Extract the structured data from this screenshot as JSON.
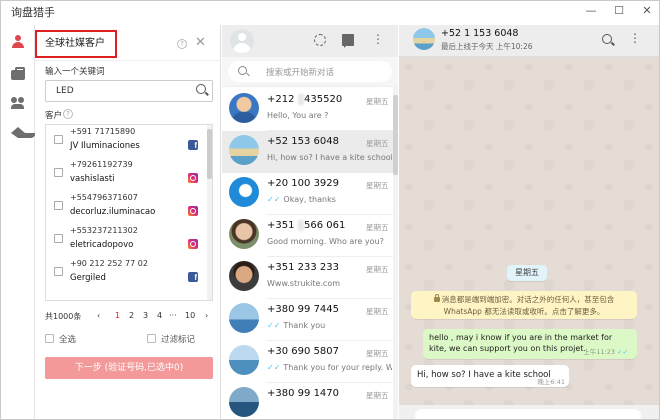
{
  "window": {
    "title": "询盘猎手",
    "controls": [
      "minimize",
      "maximize",
      "close"
    ]
  },
  "rail": {
    "icons": [
      "user-icon",
      "briefcase-icon",
      "group-icon",
      "graduation-cap-icon"
    ],
    "active_color": "#e0474c"
  },
  "left_panel": {
    "title": "全球社媒客户",
    "keyword_label": "输入一个关键词",
    "keyword_value": "LED",
    "customers_label": "客户",
    "customers": [
      {
        "phone": "+591 71715890",
        "name": "JV Iluminaciones",
        "platform": "facebook"
      },
      {
        "phone": "+79261192739",
        "name": "vashislasti",
        "platform": "instagram"
      },
      {
        "phone": "+554796371607",
        "name": "decorluz.iluminacao",
        "platform": "instagram"
      },
      {
        "phone": "+553237211302",
        "name": "eletricadopovo",
        "platform": "instagram"
      },
      {
        "phone": "+90 212 252 77 02",
        "name": "Gergiled",
        "platform": "facebook"
      }
    ],
    "pager": {
      "total": "共1000条",
      "prev": "‹",
      "pages": [
        "1",
        "2",
        "3",
        "4"
      ],
      "current": "1",
      "ellipsis": "···",
      "last": "10",
      "next": "›"
    },
    "select_all": "全选",
    "filter_marked": "过滤标记",
    "next_button": "下一步 (验证号码,已选中0)",
    "accent": "#e02020",
    "button_color": "#f39999"
  },
  "chat_list": {
    "search_placeholder": "搜索或开始新对话",
    "items": [
      {
        "name_prefix": "+212 ",
        "name_hidden": "6",
        "name_suffix": "435520",
        "time": "星期五",
        "preview": "Hello, You are ?",
        "ticks": false,
        "selected": false,
        "avatar": "blue-person"
      },
      {
        "name_prefix": "+52 1",
        "name_hidden": "    ",
        "name_suffix": "53 6048",
        "time": "星期五",
        "preview": "Hi, how so? I have a kite school",
        "ticks": false,
        "selected": true,
        "avatar": "kite-beach"
      },
      {
        "name_prefix": "+20 100 ",
        "name_hidden": "   ",
        "name_suffix": "3929",
        "time": "星期五",
        "preview": "Okay, thanks",
        "ticks": true,
        "selected": false,
        "avatar": "blue-logo"
      },
      {
        "name_prefix": "+351 ",
        "name_hidden": "9",
        "name_suffix": "566 061",
        "time": "星期五",
        "preview": "Good morning. Who are you?",
        "ticks": false,
        "selected": false,
        "avatar": "woman"
      },
      {
        "name_prefix": "+351 ",
        "name_hidden": "   ",
        "name_suffix": "233 233",
        "time": "星期五",
        "preview": "Www.strukite.com",
        "ticks": false,
        "selected": false,
        "avatar": "man"
      },
      {
        "name_prefix": "+380 99 ",
        "name_hidden": "    ",
        "name_suffix": "7445",
        "time": "星期五",
        "preview": "Thank you",
        "ticks": true,
        "selected": false,
        "avatar": "sea-kite"
      },
      {
        "name_prefix": "+30 690 ",
        "name_hidden": "   ",
        "name_suffix": "5807",
        "time": "星期五",
        "preview": "Thank you for your reply. We...",
        "ticks": true,
        "selected": false,
        "avatar": "rider"
      },
      {
        "name_prefix": "+380 99 ",
        "name_hidden": "    ",
        "name_suffix": "1470",
        "time": "星期五",
        "preview": "",
        "ticks": false,
        "selected": false,
        "avatar": "surf"
      }
    ]
  },
  "conversation": {
    "name_prefix": "+52 1 ",
    "name_hidden": "     ",
    "name_suffix": "153 6048",
    "status": "最后上线于今天 上午10:26",
    "date_chip": "星期五",
    "encryption_note": "消息都是端到端加密。对话之外的任何人，甚至包含 WhatsApp 都无法读取或收听。点击了解更多。",
    "messages": [
      {
        "direction": "out",
        "text": "hello , may i know if you are in the market for kite, we can support you on this projet.",
        "time": "上午11:23"
      },
      {
        "direction": "in",
        "text": "Hi, how so? I have a kite school",
        "time": "晚上6:41"
      }
    ],
    "wallpaper_color": "#e5ddd5",
    "out_bubble_color": "#dcf8c6",
    "note_color": "#fff5c4"
  }
}
